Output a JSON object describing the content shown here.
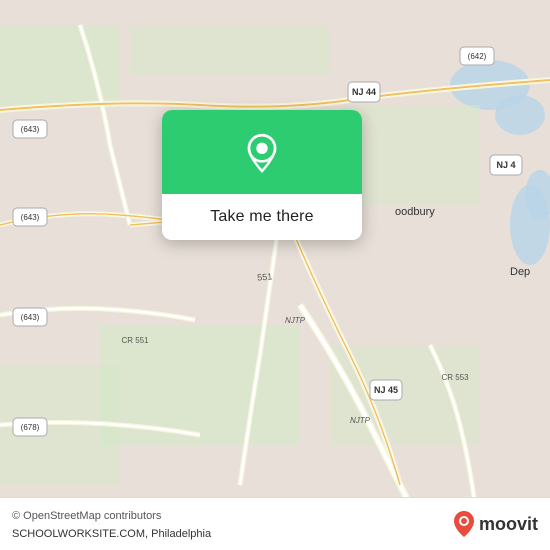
{
  "map": {
    "background_color": "#e8e0d8"
  },
  "popup": {
    "button_label": "Take me there",
    "icon_color": "#2ecc71"
  },
  "bottom_bar": {
    "copyright": "© OpenStreetMap contributors",
    "app_name": "moovit",
    "location": "SCHOOLWORKSITE.COM, Philadelphia"
  },
  "road_labels": {
    "nj44": "NJ 44",
    "nj45": "NJ 45",
    "cr551a": "CR 551",
    "cr551b": "551",
    "cr643a": "(643)",
    "cr643b": "(643)",
    "cr643c": "(643)",
    "cr642": "(642)",
    "cr678": "(678)",
    "cr553": "CR 553",
    "njtp": "NJTP",
    "woodbury": "oodbury",
    "dep": "Dep"
  },
  "icons": {
    "location_pin": "location-pin-icon",
    "moovit_pin": "moovit-pin-icon"
  }
}
